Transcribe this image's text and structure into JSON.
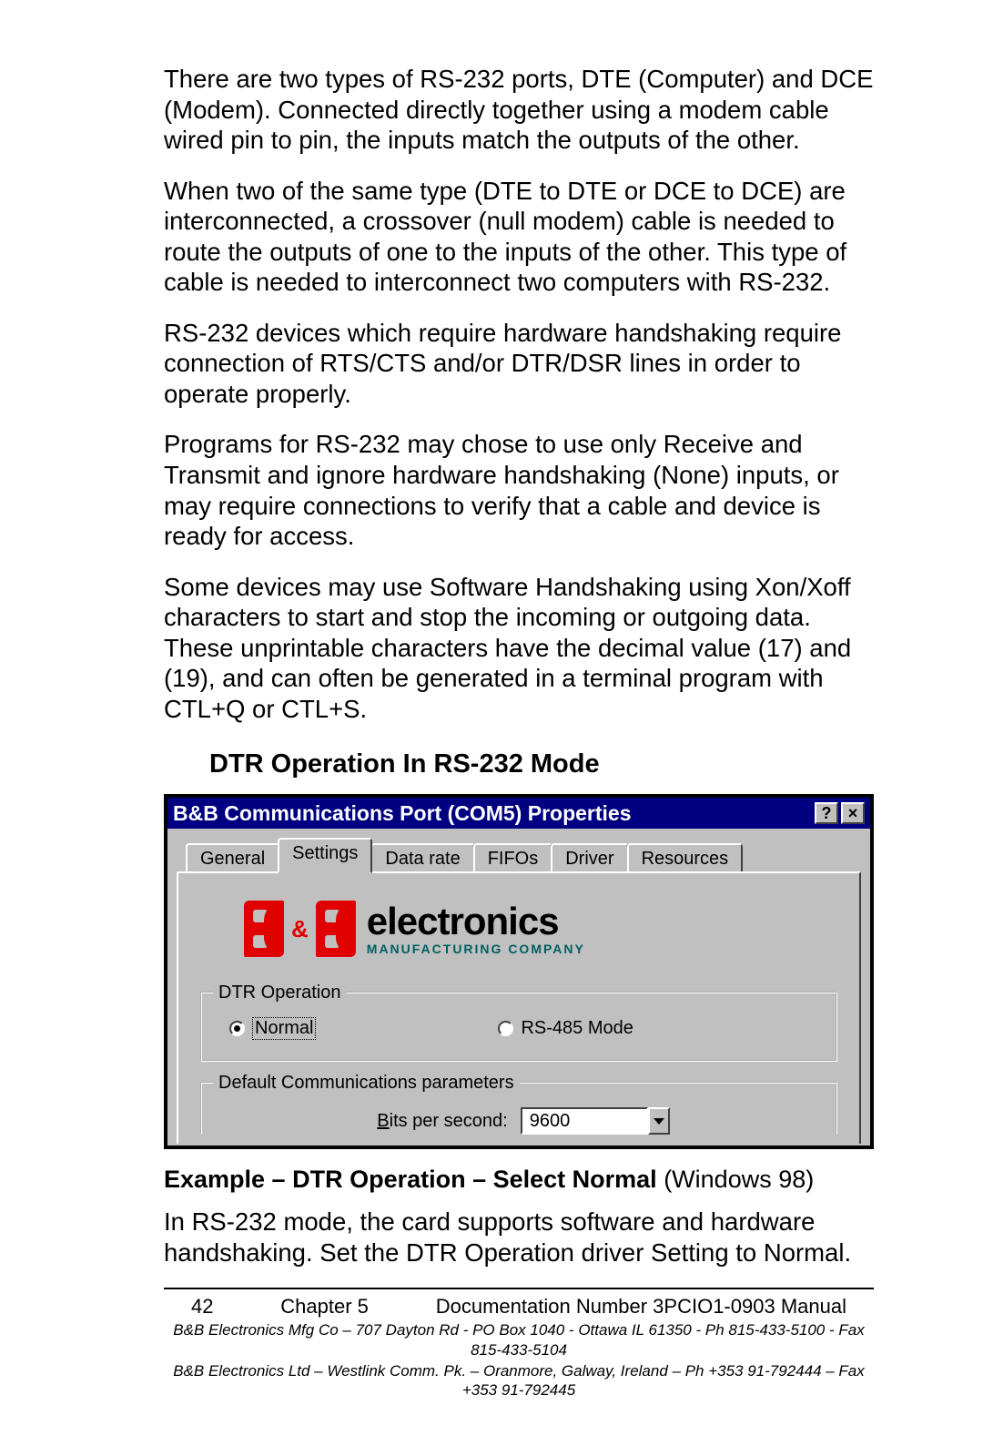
{
  "paragraphs": {
    "p1": "There are two types of RS-232 ports, DTE (Computer) and DCE (Modem). Connected directly together using a modem cable wired pin to pin, the inputs match the outputs of the other.",
    "p2": "When two of the same type (DTE to DTE or DCE to DCE) are interconnected, a crossover (null modem) cable is needed to route the outputs of one to the inputs of the other. This type of cable is needed to interconnect two computers with RS-232.",
    "p3": "RS-232 devices which require hardware handshaking require connection of RTS/CTS and/or DTR/DSR lines in order to operate properly.",
    "p4": "Programs for RS-232 may chose to use only Receive and Transmit and ignore hardware handshaking (None) inputs, or may require connections to verify that a cable and device is ready for access.",
    "p5": "Some devices may use Software Handshaking using Xon/Xoff characters to start and stop the incoming or outgoing data. These unprintable characters have the decimal value (17) and (19), and can often be generated in a terminal program with CTL+Q or CTL+S.",
    "p6": "In RS-232 mode, the card supports software and hardware handshaking. Set the DTR Operation driver Setting to Normal."
  },
  "heading": "DTR Operation In RS-232 Mode",
  "caption": {
    "bold": "Example – DTR Operation – Select Normal ",
    "rest": "(Windows 98)"
  },
  "dialog": {
    "title": "B&B Communications Port (COM5) Properties",
    "help_glyph": "?",
    "close_glyph": "×",
    "tabs": {
      "t0": "General",
      "t1": "Settings",
      "t2": "Data rate",
      "t3": "FIFOs",
      "t4": "Driver",
      "t5": "Resources"
    },
    "logo": {
      "main": "electronics",
      "sub": "MANUFACTURING COMPANY",
      "amp": "&"
    },
    "group1": {
      "title": "DTR Operation",
      "opt_normal": "Normal",
      "opt_rs485": "RS-485 Mode"
    },
    "group2": {
      "title": "Default Communications parameters",
      "bps_label_u": "B",
      "bps_label_rest": "its per second:",
      "bps_value": "9600"
    }
  },
  "footer": {
    "page": "42",
    "chapter": "Chapter 5",
    "doc": "Documentation Number 3PCIO1-0903 Manual",
    "addr1": "B&B Electronics Mfg Co – 707 Dayton Rd - PO Box 1040 - Ottawa IL 61350 - Ph 815-433-5100 - Fax 815-433-5104",
    "addr2": "B&B Electronics Ltd – Westlink Comm. Pk. – Oranmore, Galway, Ireland – Ph +353 91-792444 – Fax +353 91-792445"
  }
}
